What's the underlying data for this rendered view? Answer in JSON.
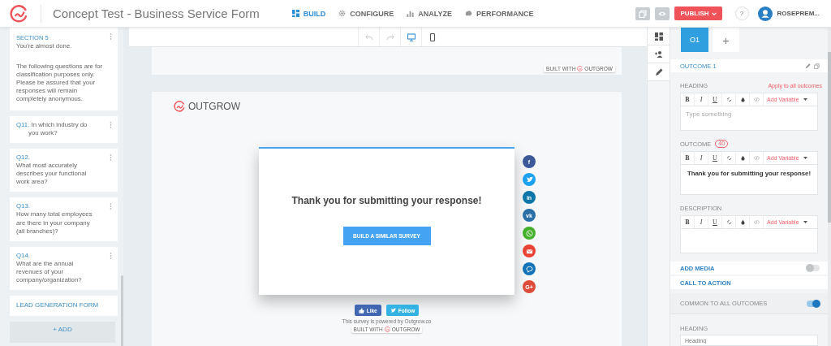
{
  "header": {
    "title": "Concept Test - Business Service Form",
    "nav": [
      {
        "label": "BUILD",
        "selected": true
      },
      {
        "label": "CONFIGURE",
        "selected": false
      },
      {
        "label": "ANALYZE",
        "selected": false
      },
      {
        "label": "PERFORMANCE",
        "selected": false
      }
    ],
    "publish": "PUBLISH",
    "help": "?",
    "user": "ROSEPREM..."
  },
  "sidebar": {
    "section": {
      "label": "SECTION 5",
      "title": "You're almost done.",
      "text": "The following questions are for classification purposes only. Please be assured that your responses will remain completely anonymous."
    },
    "questions": [
      {
        "kind": "inline",
        "number": "Q11.",
        "text": "In which industry do you work?"
      },
      {
        "kind": "stacked",
        "number": "Q12.",
        "text": "What most accurately describes your functional work area?"
      },
      {
        "kind": "stacked",
        "number": "Q13.",
        "text": "How many total employees are there in your company (all branches)?"
      },
      {
        "kind": "stacked",
        "number": "Q14.",
        "text": "What are the annual revenues of your company/organization?"
      }
    ],
    "lead_form": "LEAD GENERATION FORM",
    "add_button": "+ ADD"
  },
  "preview": {
    "badges": [
      {
        "prefix": "BUILT WITH",
        "brand": "OUTGROW"
      },
      {
        "prefix": "BUILT WITH",
        "brand": "OUTGROW"
      }
    ],
    "brand": "OUTGROW",
    "message": "Thank you for submitting your response!",
    "button": "BUILD A SIMILAR SURVEY",
    "share": [
      {
        "kind": "text",
        "label": "f",
        "color": "#3b5998"
      },
      {
        "kind": "bird",
        "color": "#1da1f2"
      },
      {
        "kind": "text",
        "label": "in",
        "color": "#0e76a8"
      },
      {
        "kind": "text",
        "label": "vk",
        "color": "#2a6fa6"
      },
      {
        "kind": "phone",
        "color": "#43b02a"
      },
      {
        "kind": "mail",
        "color": "#ea4335"
      },
      {
        "kind": "chat",
        "color": "#1473b8"
      },
      {
        "kind": "text",
        "label": "G+",
        "color": "#dd4b39"
      }
    ],
    "like": "Like",
    "follow": "Follow",
    "powered": "This survey is powered by Outgrow.co"
  },
  "panel": {
    "outcome_tabs": [
      {
        "label": "O1",
        "selected": true
      }
    ],
    "add_tab": "+",
    "outcome_title": "OUTCOME 1",
    "editors": [
      {
        "label": "HEADING",
        "action": "Apply to all outcomes",
        "tools": [
          "B",
          "I",
          "U"
        ],
        "variable": "Add Variable",
        "placeholder": "Type something"
      },
      {
        "label": "OUTCOME",
        "badge": "40",
        "tools": [
          "B",
          "I",
          "U"
        ],
        "variable": "Add Variable",
        "value": "Thank you for submitting your response!"
      },
      {
        "label": "DESCRIPTION",
        "tools": [
          "B",
          "I",
          "U"
        ],
        "variable": "Add Variable"
      }
    ],
    "rows": [
      {
        "kind": "link",
        "label": "ADD MEDIA",
        "on": false
      },
      {
        "kind": "link",
        "label": "CALL TO ACTION"
      },
      {
        "kind": "option",
        "label": "COMMON TO ALL OUTCOMES",
        "on": true
      }
    ],
    "last_field": {
      "label": "HEADING",
      "placeholder": "Heading"
    }
  }
}
